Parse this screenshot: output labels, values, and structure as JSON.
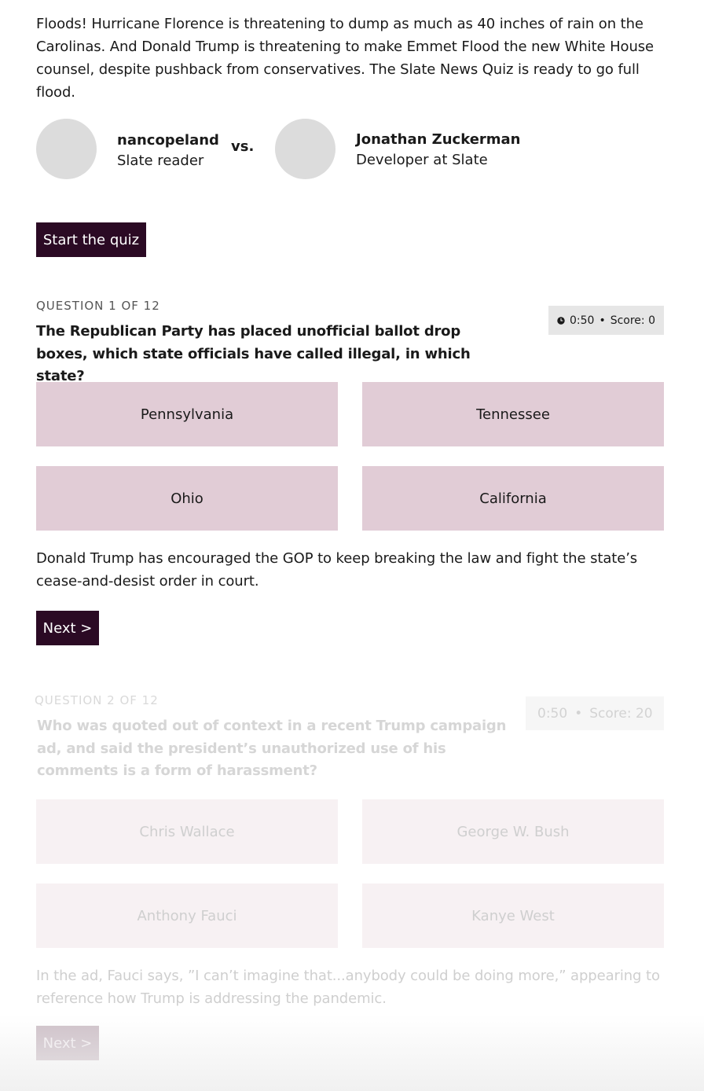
{
  "intro": "Floods! Hurricane Florence is threatening to dump as much as 40 inches of rain on the Carolinas. And Donald Trump is threatening to make Emmet Flood the new White House counsel, despite pushback from conservatives. The Slate News Quiz is ready to go full flood.",
  "players": [
    {
      "name": "nancopeland",
      "role": "Slate reader"
    },
    {
      "name": "Jonathan Zuckerman",
      "role": "Developer at Slate"
    }
  ],
  "vs": "vs.",
  "start_label": "Start the quiz",
  "questions": [
    {
      "label": "QUESTION 1 OF 12",
      "text": "The Republican Party has placed unofficial ballot drop boxes, which state officials have called illegal, in which state?",
      "timer": "0:50",
      "score": "Score: 0",
      "answers": [
        "Pennsylvania",
        "Tennessee",
        "Ohio",
        "California"
      ],
      "explanation": "Donald Trump has encouraged the GOP to keep breaking the law and fight the state’s cease-and-desist order in court.",
      "next_label": "Next >"
    },
    {
      "label": "QUESTION 2 OF 12",
      "text": "Who was quoted out of context in a recent Trump campaign ad, and said the president’s unauthorized use of his comments is a form of harassment?",
      "timer": "0:50",
      "score": "Score: 20",
      "answers": [
        "Chris Wallace",
        "George W. Bush",
        "Anthony Fauci",
        "Kanye West"
      ],
      "explanation": "In the ad, Fauci says, ”I can’t imagine that...anybody could be doing more,” appearing to reference how Trump is addressing the pandemic.",
      "next_label": "Next >"
    }
  ],
  "separator": "•",
  "colors": {
    "button": "#2b0a24",
    "answer_bg": "#e1ccd6",
    "faded_answer_bg": "#f7f1f3"
  }
}
